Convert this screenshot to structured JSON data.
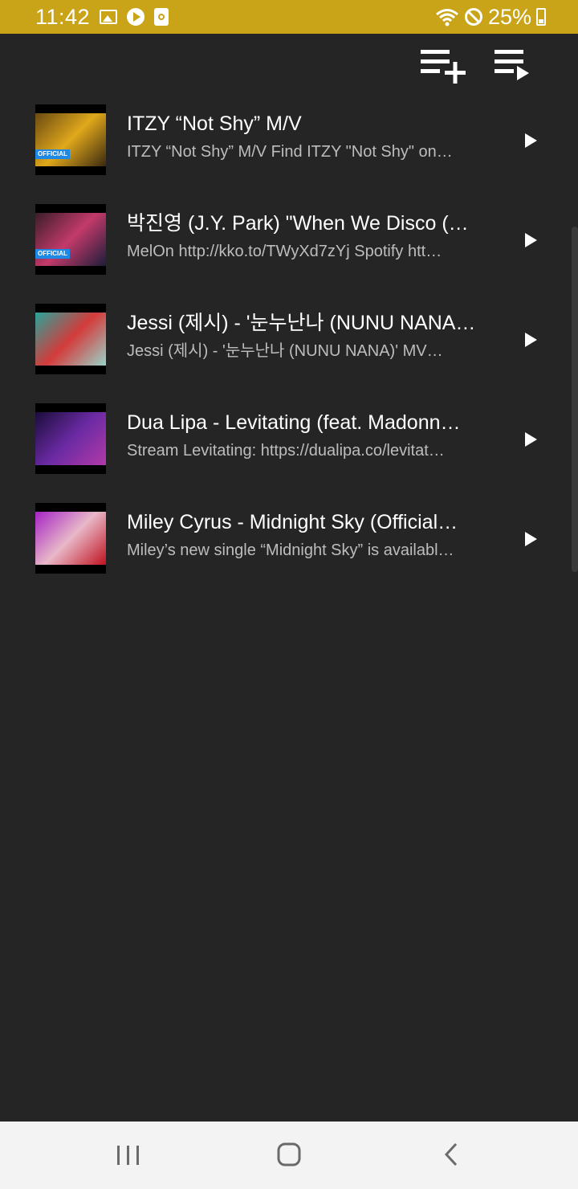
{
  "status_bar": {
    "time": "11:42",
    "battery": "25%",
    "icons": [
      "gallery-icon",
      "play-circle-icon",
      "square-app-icon",
      "wifi-icon",
      "do-not-disturb-icon",
      "battery-icon"
    ],
    "bg_color": "#c9a419"
  },
  "toolbar": {
    "add_to_playlist_icon": "playlist-add-icon",
    "play_playlist_icon": "playlist-play-icon"
  },
  "videos": [
    {
      "title": "ITZY “Not Shy” M/V",
      "subtitle": "ITZY “Not Shy” M/V  Find ITZY \"Not Shy\" on…",
      "thumb_colors": [
        "#6a4a12",
        "#e0a81b",
        "#3a2810"
      ],
      "badge": "OFFICIAL"
    },
    {
      "title": "박진영 (J.Y. Park) \"When We Disco (D…",
      "subtitle": "MelOn http://kko.to/TWyXd7zYj Spotify htt…",
      "thumb_colors": [
        "#3b1d2a",
        "#c33a6a",
        "#1d1d3a"
      ],
      "badge": "OFFICIAL"
    },
    {
      "title": "Jessi (제시) - '눈누난나 (NUNU NANA…",
      "subtitle": "Jessi (제시) - '눈누난나 (NUNU NANA)' MV…",
      "thumb_colors": [
        "#2aa39a",
        "#d33b3b",
        "#9ad3c9"
      ],
      "badge": ""
    },
    {
      "title": "Dua Lipa - Levitating (feat. Madonn…",
      "subtitle": "Stream Levitating: https://dualipa.co/levitat…",
      "thumb_colors": [
        "#1a0d3a",
        "#6a2aa3",
        "#b23aa8"
      ],
      "badge": ""
    },
    {
      "title": "Miley Cyrus - Midnight Sky (Official…",
      "subtitle": "Miley’s new single “Midnight Sky” is availabl…",
      "thumb_colors": [
        "#a524c4",
        "#e8b8c8",
        "#c0121e"
      ],
      "badge": ""
    }
  ],
  "nav": {
    "recent_icon": "recent-apps-icon",
    "home_icon": "home-icon",
    "back_icon": "back-icon"
  }
}
